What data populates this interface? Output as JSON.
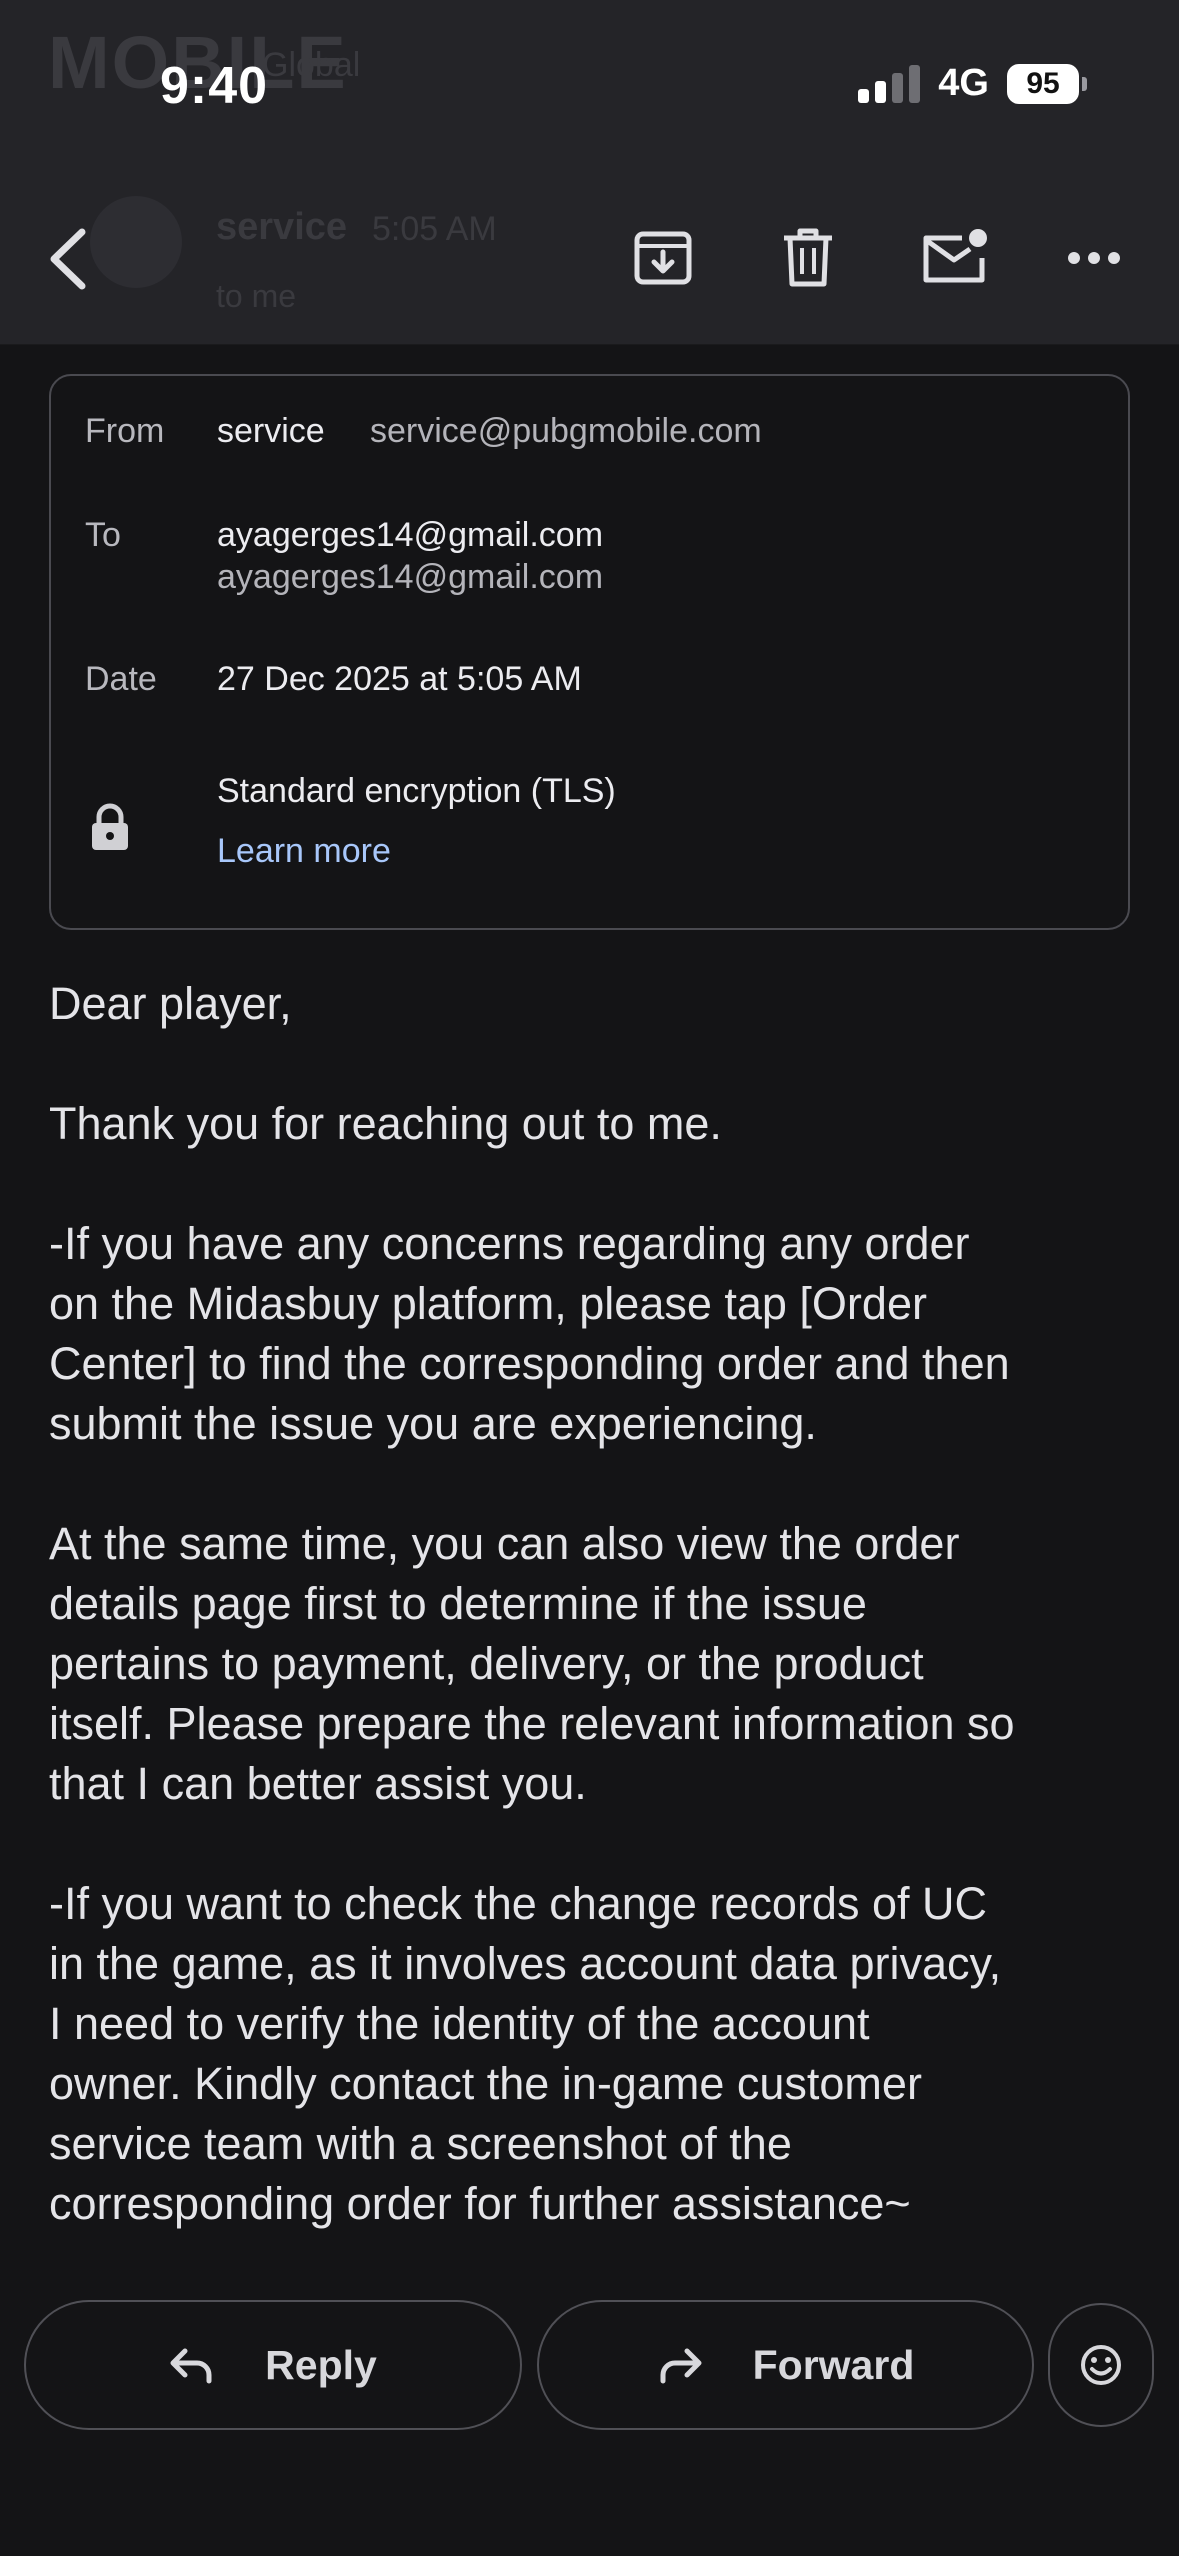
{
  "status_bar": {
    "time": "9:40",
    "network": "4G",
    "battery": "95"
  },
  "background": {
    "logo": "MOBILE",
    "logo_sub": "Global",
    "sender": "service",
    "time": "5:05 AM",
    "to_me": "to me"
  },
  "toolbar": {
    "icons": [
      "back-icon",
      "archive-icon",
      "delete-icon",
      "mark-unread-icon",
      "more-icon"
    ]
  },
  "details": {
    "from_label": "From",
    "from_name": "service",
    "from_email": "service@pubgmobile.com",
    "to_label": "To",
    "to_values": [
      "ayagerges14@gmail.com",
      "ayagerges14@gmail.com"
    ],
    "date_label": "Date",
    "date_value": "27 Dec 2025 at 5:05 AM",
    "encryption": "Standard encryption (TLS)",
    "learn_more": "Learn more"
  },
  "body": {
    "paragraphs": [
      "Dear player,",
      "Thank you for reaching out to me.",
      "-If you have any concerns regarding any order\non the Midasbuy platform, please tap [Order\nCenter] to find the corresponding order and then\nsubmit the issue you are experiencing.",
      "At the same time, you can also view the order\ndetails page first to determine if the issue\npertains to payment, delivery, or the product\nitself. Please prepare the relevant information so\nthat I can better assist you.",
      "-If you want to check the change records of UC\nin the game, as it involves account data privacy,\nI need to verify the identity of the account\nowner. Kindly contact the in-game customer\nservice team with a screenshot of the\ncorresponding order for further assistance~"
    ]
  },
  "actions": {
    "reply": "Reply",
    "forward": "Forward"
  },
  "colors": {
    "background": "#141416",
    "header": "#242428",
    "link": "#a8c7fa"
  }
}
